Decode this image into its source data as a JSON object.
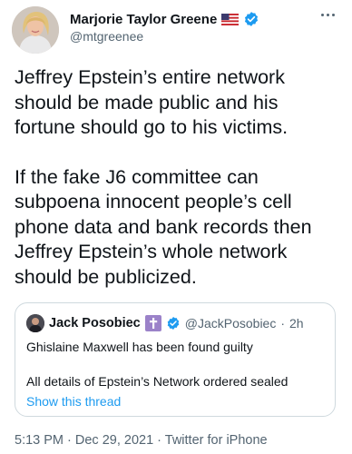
{
  "author": {
    "display_name": "Marjorie Taylor Greene",
    "handle": "@mtgreenee",
    "avatar_icon": "profile-photo",
    "flag_icon": "us-flag-icon",
    "verified_icon": "verified-badge-icon",
    "more_icon": "more-options-icon"
  },
  "tweet": {
    "paragraphs": [
      "Jeffrey Epstein’s entire network should be made public and his fortune should go to his victims.",
      "If the fake J6 committee can subpoena innocent people’s cell phone data and bank records then Jeffrey Epstein’s whole network should be publicized."
    ]
  },
  "quoted_tweet": {
    "display_name": "Jack Posobiec",
    "handle": "@JackPosobiec",
    "separator": "·",
    "time": "2h",
    "line1": "Ghislaine Maxwell has been found guilty",
    "line2": "All details of Epstein’s Network ordered sealed",
    "show_thread": "Show this thread",
    "cross_icon": "cross-emoji-icon",
    "verified_icon": "verified-badge-icon"
  },
  "meta": {
    "text": "5:13 PM · Dec 29, 2021 · Twitter for iPhone"
  },
  "colors": {
    "text": "#0f1419",
    "secondary": "#536471",
    "link": "#1d9bf0",
    "verified": "#1d9bf0",
    "border": "#cfd9de"
  }
}
